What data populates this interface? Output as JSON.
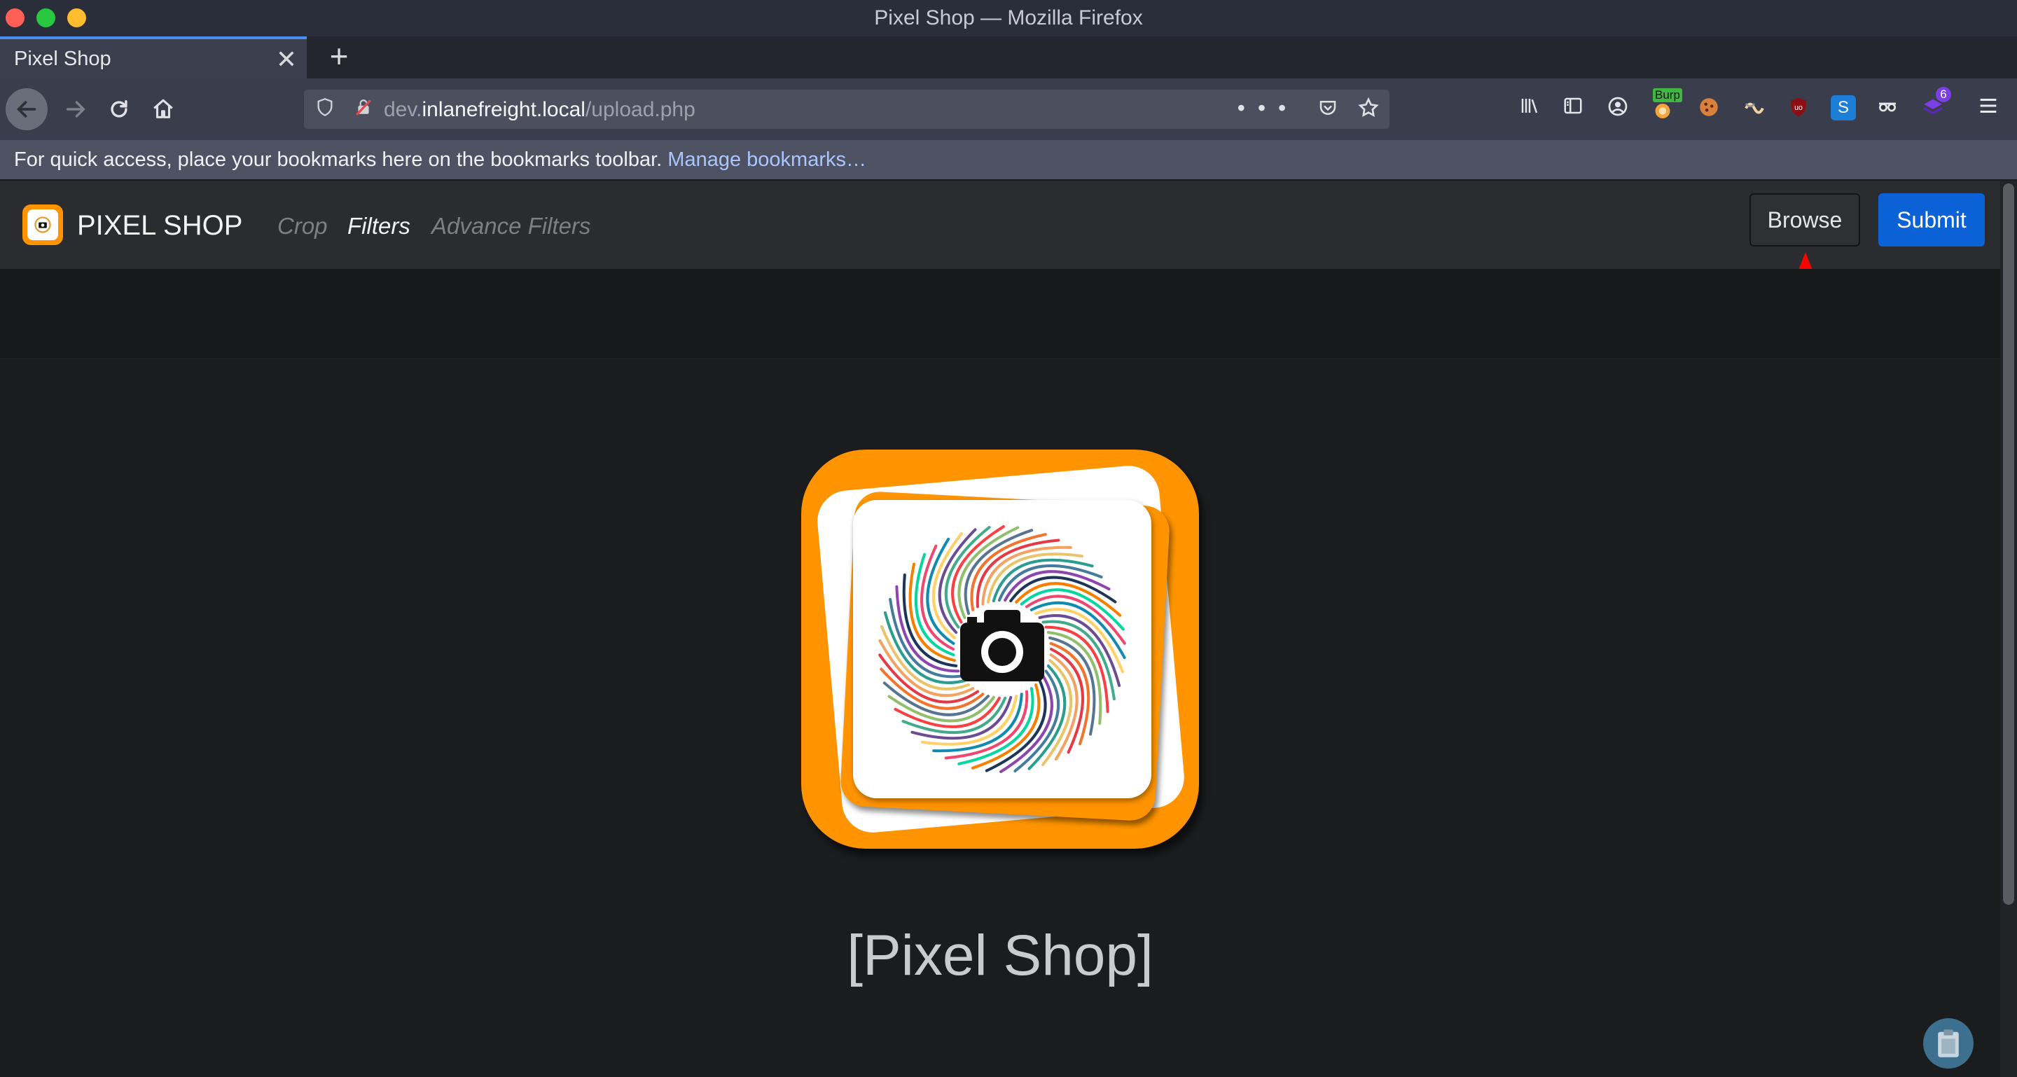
{
  "window": {
    "title": "Pixel Shop — Mozilla Firefox"
  },
  "tab": {
    "title": "Pixel Shop",
    "close": "✕",
    "new_tab": "+"
  },
  "toolbar": {
    "url_prefix": "dev.",
    "url_host": "inlanefreight.local",
    "url_path": "/upload.php",
    "extensions": [
      "library-icon",
      "sidebar-icon",
      "account-icon",
      "burp-icon",
      "cookie-icon",
      "wappalyzer-icon",
      "ublock-icon",
      "s-extension-icon",
      "spy-icon",
      "stack-icon"
    ],
    "burp_label": "Burp",
    "stack_badge": "6"
  },
  "bookmarks": {
    "hint": "For quick access, place your bookmarks here on the bookmarks toolbar. ",
    "manage_link": "Manage bookmarks…"
  },
  "site": {
    "brand": "PIXEL SHOP",
    "nav": [
      {
        "label": "Crop",
        "active": false
      },
      {
        "label": "Filters",
        "active": true
      },
      {
        "label": "Advance Filters",
        "active": false
      }
    ],
    "browse_label": "Browse",
    "submit_label": "Submit",
    "heading": "[Pixel Shop]"
  },
  "colors": {
    "accent_orange": "#ff9400",
    "submit_blue": "#0b62d6",
    "annotation_arrow": "#ff0000"
  }
}
